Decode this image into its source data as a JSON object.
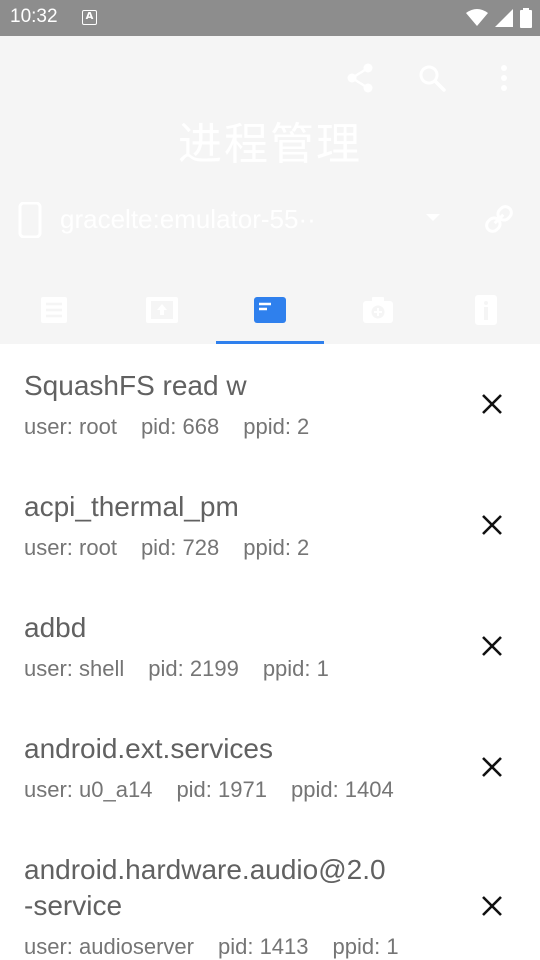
{
  "status_bar": {
    "time": "10:32",
    "notification_badge": "A"
  },
  "toolbar": {
    "title": "进程管理",
    "actions": [
      "share-icon",
      "search-icon",
      "more-vert-icon"
    ],
    "text_color": "#ffffff",
    "background": "#f5f5f5"
  },
  "device": {
    "name": "gracelte:emulator-55··"
  },
  "tabs": {
    "items": [
      "file-list-icon",
      "upload-icon",
      "process-icon",
      "camera-icon",
      "info-icon"
    ],
    "selected_index": 2,
    "accent": "#2f80ed"
  },
  "processes": [
    {
      "name": "SquashFS read w",
      "user": "user: root",
      "pid": "pid: 668",
      "ppid": "ppid: 2"
    },
    {
      "name": "acpi_thermal_pm",
      "user": "user: root",
      "pid": "pid: 728",
      "ppid": "ppid: 2"
    },
    {
      "name": "adbd",
      "user": "user: shell",
      "pid": "pid: 2199",
      "ppid": "ppid: 1"
    },
    {
      "name": "android.ext.services",
      "user": "user: u0_a14",
      "pid": "pid: 1971",
      "ppid": "ppid: 1404"
    },
    {
      "name": "android.hardware.audio@2.0\n-service",
      "user": "user: audioserver",
      "pid": "pid: 1413",
      "ppid": "ppid: 1"
    }
  ]
}
